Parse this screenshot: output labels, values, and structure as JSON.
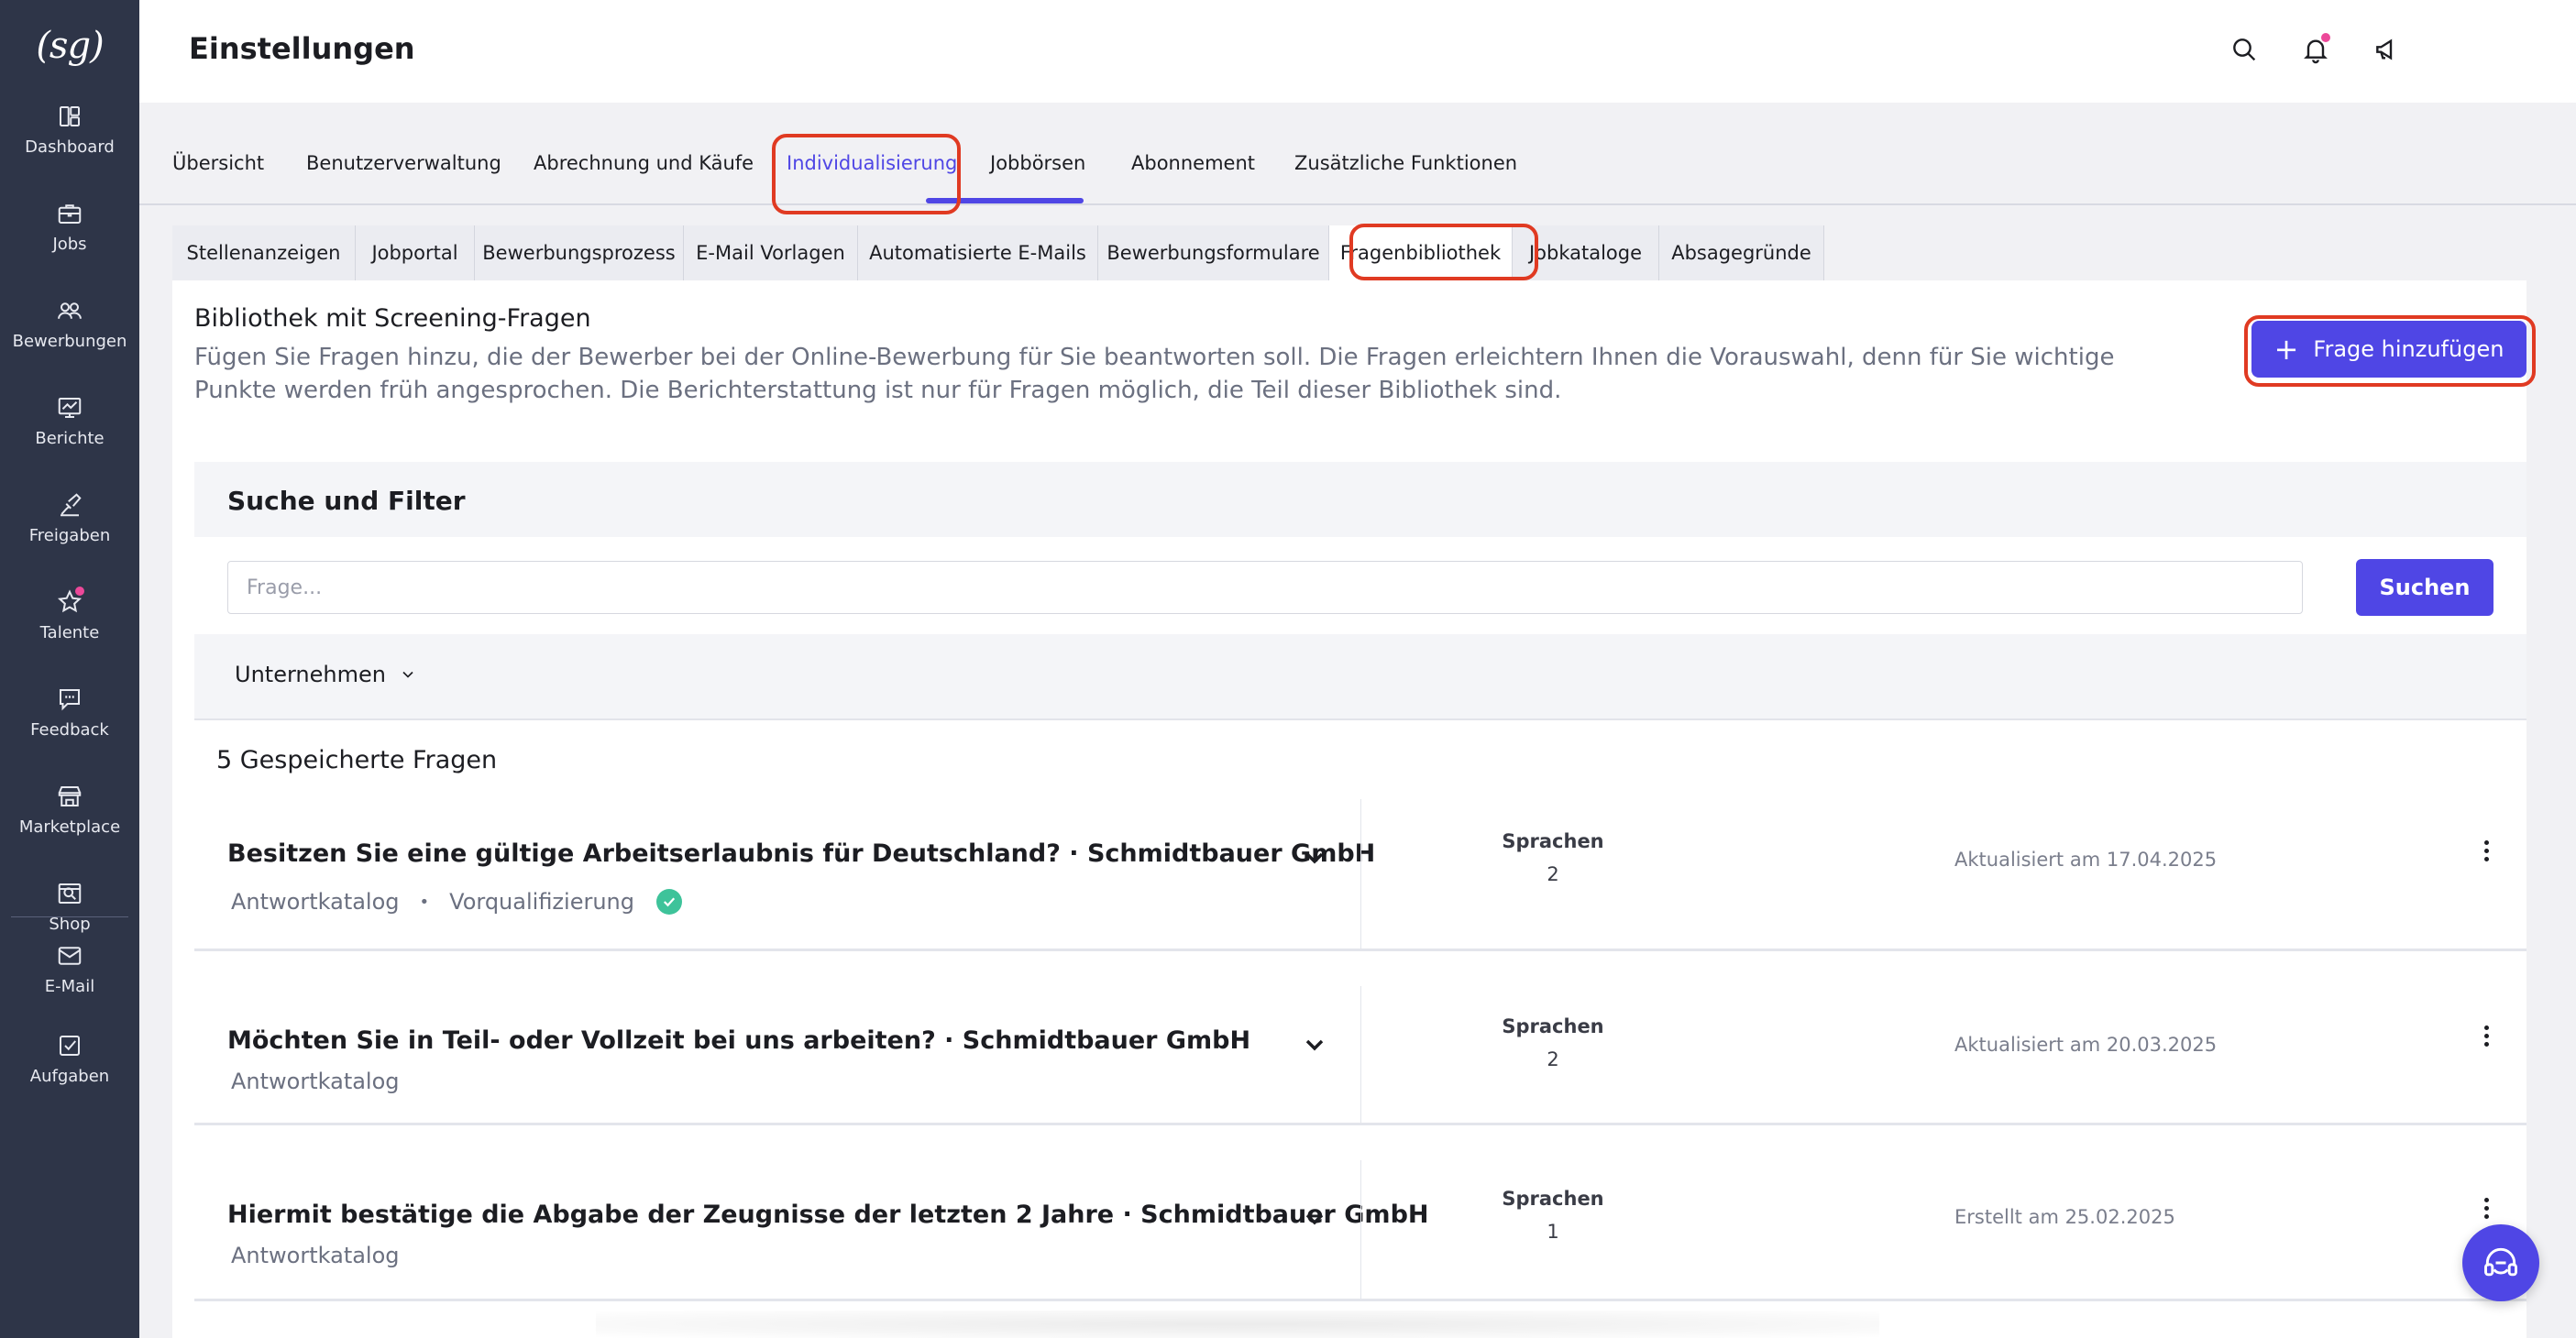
{
  "sidebar": {
    "logo": "(sg)",
    "items": [
      {
        "label": "Dashboard",
        "icon": "dashboard-icon"
      },
      {
        "label": "Jobs",
        "icon": "briefcase-icon"
      },
      {
        "label": "Bewerbungen",
        "icon": "users-icon"
      },
      {
        "label": "Berichte",
        "icon": "report-icon"
      },
      {
        "label": "Freigaben",
        "icon": "approval-icon"
      },
      {
        "label": "Talente",
        "icon": "star-icon"
      },
      {
        "label": "Feedback",
        "icon": "feedback-icon"
      },
      {
        "label": "Marketplace",
        "icon": "store-icon"
      },
      {
        "label": "Shop",
        "icon": "shop-icon"
      },
      {
        "label": "E-Mail",
        "icon": "mail-icon"
      },
      {
        "label": "Aufgaben",
        "icon": "tasks-icon"
      }
    ]
  },
  "header": {
    "title": "Einstellungen",
    "icons": [
      "search-icon",
      "bell-icon",
      "megaphone-icon",
      "avatar",
      "chevron-down-icon"
    ]
  },
  "main_tabs": [
    {
      "label": "Übersicht"
    },
    {
      "label": "Benutzerverwaltung"
    },
    {
      "label": "Abrechnung und Käufe"
    },
    {
      "label": "Individualisierung",
      "active": true
    },
    {
      "label": "Jobbörsen"
    },
    {
      "label": "Abonnement"
    },
    {
      "label": "Zusätzliche Funktionen"
    }
  ],
  "sub_tabs": [
    {
      "label": "Stellenanzeigen"
    },
    {
      "label": "Jobportal"
    },
    {
      "label": "Bewerbungsprozess"
    },
    {
      "label": "E-Mail Vorlagen"
    },
    {
      "label": "Automatisierte E-Mails"
    },
    {
      "label": "Bewerbungsformulare"
    },
    {
      "label": "Fragenbibliothek",
      "active": true
    },
    {
      "label": "Jobkataloge"
    },
    {
      "label": "Absagegründe"
    }
  ],
  "library": {
    "title": "Bibliothek mit Screening-Fragen",
    "description": "Fügen Sie Fragen hinzu, die der Bewerber bei der Online-Bewerbung für Sie beantworten soll. Die Fragen erleichtern Ihnen die Vorauswahl, denn für Sie wichtige Punkte werden früh angesprochen. Die Berichterstattung ist nur für Fragen möglich, die Teil dieser Bibliothek sind.",
    "add_button": "Frage hinzufügen"
  },
  "filter": {
    "title": "Suche und Filter",
    "search_placeholder": "Frage...",
    "search_value": "",
    "search_button": "Suchen",
    "company_filter": "Unternehmen"
  },
  "questions_summary": "5 Gespeicherte Fragen",
  "questions": [
    {
      "title": "Besitzen Sie eine gültige Arbeitserlaubnis für Deutschland? · Schmidtbauer GmbH",
      "meta": "Antwortkatalog",
      "meta_extra": "Vorqualifizierung",
      "languages_label": "Sprachen",
      "languages": "2",
      "date": "Aktualisiert am 17.04.2025"
    },
    {
      "title": "Möchten Sie in Teil- oder Vollzeit bei uns arbeiten? · Schmidtbauer GmbH",
      "meta": "Antwortkatalog",
      "languages_label": "Sprachen",
      "languages": "2",
      "date": "Aktualisiert am 20.03.2025"
    },
    {
      "title": "Hiermit bestätige die Abgabe der Zeugnisse der letzten 2 Jahre  · Schmidtbauer GmbH",
      "meta": "Antwortkatalog",
      "languages_label": "Sprachen",
      "languages": "1",
      "date": "Erstellt am 25.02.2025"
    }
  ],
  "colors": {
    "accent": "#4f46e5",
    "sidebar": "#2e3548",
    "highlight": "#e03a22",
    "success": "#3ec39a",
    "notification": "#ec4899"
  }
}
